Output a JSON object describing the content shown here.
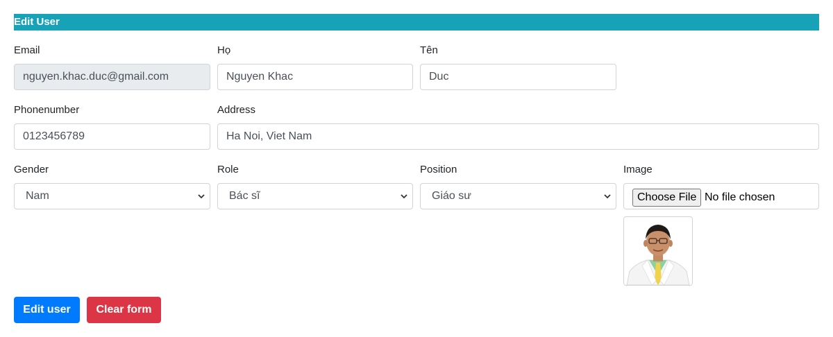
{
  "form": {
    "title": "Edit User",
    "email": {
      "label": "Email",
      "value": "nguyen.khac.duc@gmail.com"
    },
    "last_name": {
      "label": "Họ",
      "value": "Nguyen Khac"
    },
    "first_name": {
      "label": "Tên",
      "value": "Duc"
    },
    "phone": {
      "label": "Phonenumber",
      "value": "0123456789"
    },
    "address": {
      "label": "Address",
      "value": "Ha Noi, Viet Nam"
    },
    "gender": {
      "label": "Gender",
      "value": "Nam"
    },
    "role": {
      "label": "Role",
      "value": "Bác sĩ"
    },
    "position": {
      "label": "Position",
      "value": "Giáo sư"
    },
    "image": {
      "label": "Image",
      "button": "Choose File",
      "status": "No file chosen"
    }
  },
  "actions": {
    "edit": "Edit user",
    "clear": "Clear form"
  },
  "colors": {
    "header": "#17a2b8",
    "primary": "#007bff",
    "danger": "#dc3545"
  }
}
